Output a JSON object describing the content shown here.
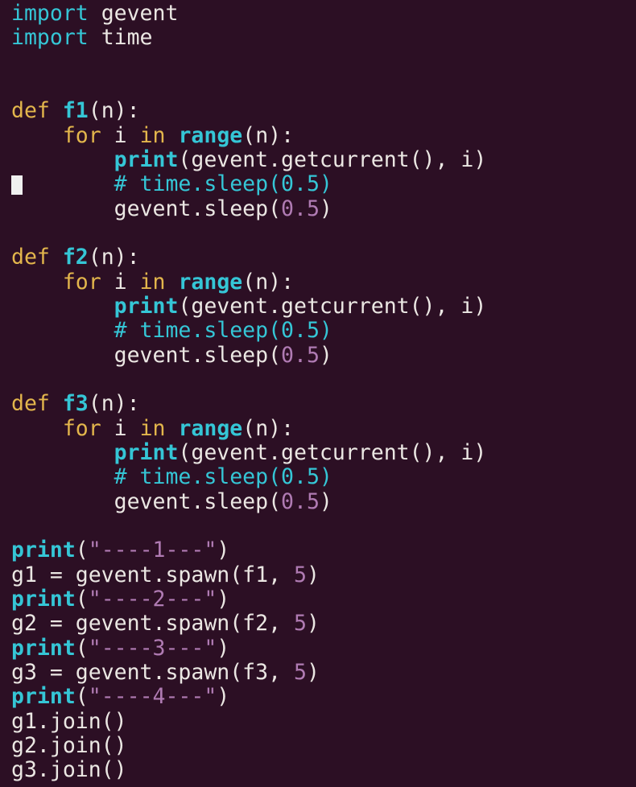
{
  "colors": {
    "background": "#2c0f24",
    "keyword": "#e3b64c",
    "function": "#35c6d6",
    "builtin": "#35c6d6",
    "comment": "#35c6d6",
    "number": "#b07bb3",
    "string": "#b07bb3",
    "identifier": "#ebe7e3",
    "cursor": "#f0f0f0"
  },
  "editor": {
    "cursor_line": 8,
    "lines": [
      [
        {
          "t": "import",
          "k": "im"
        },
        {
          "t": " gevent",
          "k": "id"
        }
      ],
      [
        {
          "t": "import",
          "k": "im"
        },
        {
          "t": " time",
          "k": "id"
        }
      ],
      [],
      [],
      [
        {
          "t": "def",
          "k": "kw"
        },
        {
          "t": " ",
          "k": "id"
        },
        {
          "t": "f1",
          "k": "fn"
        },
        {
          "t": "(n):",
          "k": "id"
        }
      ],
      [
        {
          "t": "    ",
          "k": "id"
        },
        {
          "t": "for",
          "k": "kw"
        },
        {
          "t": " i ",
          "k": "id"
        },
        {
          "t": "in",
          "k": "kw"
        },
        {
          "t": " ",
          "k": "id"
        },
        {
          "t": "range",
          "k": "bi"
        },
        {
          "t": "(n):",
          "k": "id"
        }
      ],
      [
        {
          "t": "        ",
          "k": "id"
        },
        {
          "t": "print",
          "k": "bi"
        },
        {
          "t": "(gevent.getcurrent(), i)",
          "k": "id"
        }
      ],
      [
        {
          "t": "        ",
          "k": "id"
        },
        {
          "t": "# time.sleep(0.5)",
          "k": "cm"
        }
      ],
      [
        {
          "t": "        gevent.sleep(",
          "k": "id"
        },
        {
          "t": "0.5",
          "k": "num"
        },
        {
          "t": ")",
          "k": "id"
        }
      ],
      [],
      [
        {
          "t": "def",
          "k": "kw"
        },
        {
          "t": " ",
          "k": "id"
        },
        {
          "t": "f2",
          "k": "fn"
        },
        {
          "t": "(n):",
          "k": "id"
        }
      ],
      [
        {
          "t": "    ",
          "k": "id"
        },
        {
          "t": "for",
          "k": "kw"
        },
        {
          "t": " i ",
          "k": "id"
        },
        {
          "t": "in",
          "k": "kw"
        },
        {
          "t": " ",
          "k": "id"
        },
        {
          "t": "range",
          "k": "bi"
        },
        {
          "t": "(n):",
          "k": "id"
        }
      ],
      [
        {
          "t": "        ",
          "k": "id"
        },
        {
          "t": "print",
          "k": "bi"
        },
        {
          "t": "(gevent.getcurrent(), i)",
          "k": "id"
        }
      ],
      [
        {
          "t": "        ",
          "k": "id"
        },
        {
          "t": "# time.sleep(0.5)",
          "k": "cm"
        }
      ],
      [
        {
          "t": "        gevent.sleep(",
          "k": "id"
        },
        {
          "t": "0.5",
          "k": "num"
        },
        {
          "t": ")",
          "k": "id"
        }
      ],
      [],
      [
        {
          "t": "def",
          "k": "kw"
        },
        {
          "t": " ",
          "k": "id"
        },
        {
          "t": "f3",
          "k": "fn"
        },
        {
          "t": "(n):",
          "k": "id"
        }
      ],
      [
        {
          "t": "    ",
          "k": "id"
        },
        {
          "t": "for",
          "k": "kw"
        },
        {
          "t": " i ",
          "k": "id"
        },
        {
          "t": "in",
          "k": "kw"
        },
        {
          "t": " ",
          "k": "id"
        },
        {
          "t": "range",
          "k": "bi"
        },
        {
          "t": "(n):",
          "k": "id"
        }
      ],
      [
        {
          "t": "        ",
          "k": "id"
        },
        {
          "t": "print",
          "k": "bi"
        },
        {
          "t": "(gevent.getcurrent(), i)",
          "k": "id"
        }
      ],
      [
        {
          "t": "        ",
          "k": "id"
        },
        {
          "t": "# time.sleep(0.5)",
          "k": "cm"
        }
      ],
      [
        {
          "t": "        gevent.sleep(",
          "k": "id"
        },
        {
          "t": "0.5",
          "k": "num"
        },
        {
          "t": ")",
          "k": "id"
        }
      ],
      [],
      [
        {
          "t": "print",
          "k": "bi"
        },
        {
          "t": "(",
          "k": "id"
        },
        {
          "t": "\"----1---\"",
          "k": "str"
        },
        {
          "t": ")",
          "k": "id"
        }
      ],
      [
        {
          "t": "g1 = gevent.spawn(f1, ",
          "k": "id"
        },
        {
          "t": "5",
          "k": "num"
        },
        {
          "t": ")",
          "k": "id"
        }
      ],
      [
        {
          "t": "print",
          "k": "bi"
        },
        {
          "t": "(",
          "k": "id"
        },
        {
          "t": "\"----2---\"",
          "k": "str"
        },
        {
          "t": ")",
          "k": "id"
        }
      ],
      [
        {
          "t": "g2 = gevent.spawn(f2, ",
          "k": "id"
        },
        {
          "t": "5",
          "k": "num"
        },
        {
          "t": ")",
          "k": "id"
        }
      ],
      [
        {
          "t": "print",
          "k": "bi"
        },
        {
          "t": "(",
          "k": "id"
        },
        {
          "t": "\"----3---\"",
          "k": "str"
        },
        {
          "t": ")",
          "k": "id"
        }
      ],
      [
        {
          "t": "g3 = gevent.spawn(f3, ",
          "k": "id"
        },
        {
          "t": "5",
          "k": "num"
        },
        {
          "t": ")",
          "k": "id"
        }
      ],
      [
        {
          "t": "print",
          "k": "bi"
        },
        {
          "t": "(",
          "k": "id"
        },
        {
          "t": "\"----4---\"",
          "k": "str"
        },
        {
          "t": ")",
          "k": "id"
        }
      ],
      [
        {
          "t": "g1.join()",
          "k": "id"
        }
      ],
      [
        {
          "t": "g2.join()",
          "k": "id"
        }
      ],
      [
        {
          "t": "g3.join()",
          "k": "id"
        }
      ]
    ]
  }
}
